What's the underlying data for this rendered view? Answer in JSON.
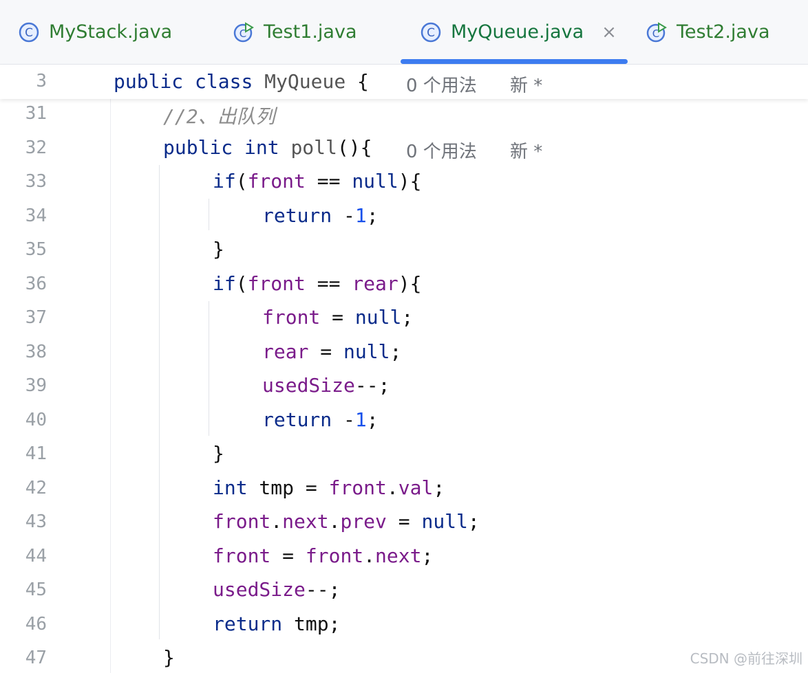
{
  "tabs": [
    {
      "label": "MyStack.java",
      "icon": "class-c-icon"
    },
    {
      "label": "Test1.java",
      "icon": "run-class-icon"
    },
    {
      "label": "MyQueue.java",
      "icon": "class-c-icon",
      "active": true
    },
    {
      "label": "Test2.java",
      "icon": "run-class-icon"
    }
  ],
  "tab_close_glyph": "×",
  "sticky": {
    "line": "3",
    "kw1": "public",
    "kw2": "class",
    "name": "MyQueue",
    "brace": "{",
    "usage": "0 个用法",
    "newtag": "新 *"
  },
  "lines": {
    "l31": {
      "n": "31",
      "comment": "//2、出队列"
    },
    "l32": {
      "n": "32",
      "a": "public",
      "b": "int",
      "c": "poll",
      "d": "(){",
      "usage": "0 个用法",
      "newtag": "新 *"
    },
    "l33": {
      "n": "33",
      "a": "if",
      "b": "(",
      "c": "front",
      "d": " == ",
      "e": "null",
      "f": "){"
    },
    "l34": {
      "n": "34",
      "a": "return",
      "b": " -",
      "c": "1",
      "d": ";"
    },
    "l35": {
      "n": "35",
      "a": "}"
    },
    "l36": {
      "n": "36",
      "a": "if",
      "b": "(",
      "c": "front",
      "d": " == ",
      "e": "rear",
      "f": "){"
    },
    "l37": {
      "n": "37",
      "a": "front",
      "b": " = ",
      "c": "null",
      "d": ";"
    },
    "l38": {
      "n": "38",
      "a": "rear",
      "b": " = ",
      "c": "null",
      "d": ";"
    },
    "l39": {
      "n": "39",
      "a": "usedSize",
      "b": "--;"
    },
    "l40": {
      "n": "40",
      "a": "return",
      "b": " -",
      "c": "1",
      "d": ";"
    },
    "l41": {
      "n": "41",
      "a": "}"
    },
    "l42": {
      "n": "42",
      "a": "int",
      "b": " tmp = ",
      "c": "front",
      "d": ".",
      "e": "val",
      "f": ";"
    },
    "l43": {
      "n": "43",
      "a": "front",
      "b": ".",
      "c": "next",
      "d": ".",
      "e": "prev",
      "f": " = ",
      "g": "null",
      "h": ";"
    },
    "l44": {
      "n": "44",
      "a": "front",
      "b": " = ",
      "c": "front",
      "d": ".",
      "e": "next",
      "f": ";"
    },
    "l45": {
      "n": "45",
      "a": "usedSize",
      "b": "--;"
    },
    "l46": {
      "n": "46",
      "a": "return",
      "b": " tmp;"
    },
    "l47": {
      "n": "47",
      "a": "}"
    }
  },
  "watermark": "CSDN @前往深圳"
}
